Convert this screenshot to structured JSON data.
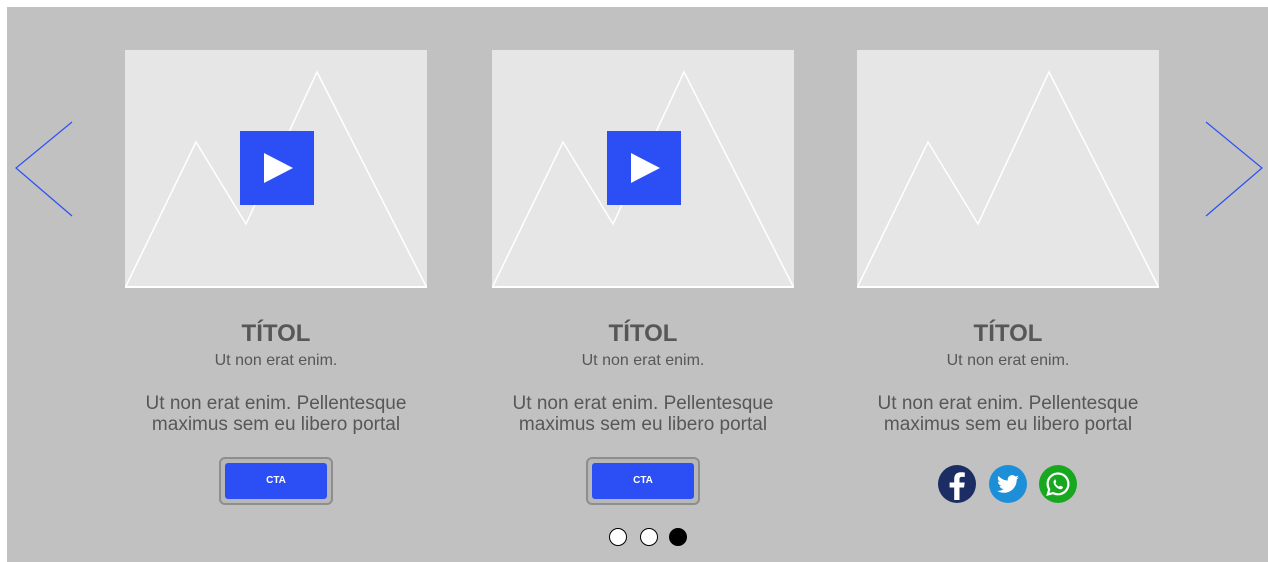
{
  "colors": {
    "background": "#c1c1c1",
    "accent": "#2b4ff5",
    "placeholder": "#e6e6e6",
    "text": "#575757"
  },
  "navigation": {
    "prev_icon": "chevron-left-icon",
    "next_icon": "chevron-right-icon"
  },
  "cards": [
    {
      "title": "TÍTOL",
      "subtitle": "Ut non erat enim.",
      "body_line1": "Ut non erat enim. Pellentesque",
      "body_line2": "maximus sem eu libero portal",
      "media": "video",
      "cta_label": "CTA"
    },
    {
      "title": "TÍTOL",
      "subtitle": "Ut non erat enim.",
      "body_line1": "Ut non erat enim. Pellentesque",
      "body_line2": "maximus sem eu libero portal",
      "media": "video",
      "cta_label": "CTA"
    },
    {
      "title": "TÍTOL",
      "subtitle": "Ut non erat enim.",
      "body_line1": "Ut non erat enim. Pellentesque",
      "body_line2": "maximus sem eu libero portal",
      "media": "image",
      "social": [
        "facebook-icon",
        "twitter-icon",
        "whatsapp-icon"
      ]
    }
  ],
  "pagination": {
    "count": 3,
    "active_index": 2
  }
}
